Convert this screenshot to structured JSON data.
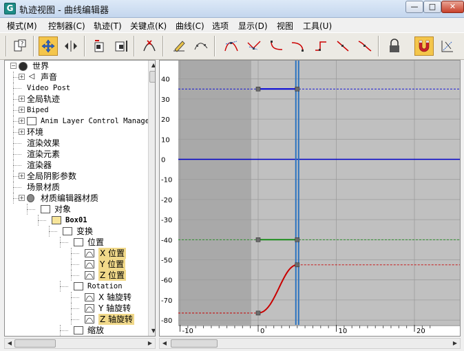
{
  "window": {
    "title": "轨迹视图 - 曲线编辑器",
    "icon_letter": "G",
    "minimize": "—",
    "maximize": "□",
    "close": "✕"
  },
  "menu": [
    "模式(M)",
    "控制器(C)",
    "轨迹(T)",
    "关键点(K)",
    "曲线(C)",
    "选项",
    "显示(D)",
    "视图",
    "工具(U)"
  ],
  "toolbar": {
    "buttons": [
      "filters-icon",
      "move-keys-icon",
      "slide-keys-icon",
      "scale-keys-icon",
      "scale-values-icon",
      "insert-keys-icon",
      "draw-curves-icon",
      "reduce-keys-icon",
      "tangent-auto-icon",
      "tangent-custom-icon",
      "tangent-fast-icon",
      "tangent-slow-icon",
      "tangent-step-icon",
      "tangent-linear-icon",
      "tangent-smooth-icon",
      "lock-selection-icon",
      "snap-frames-icon",
      "parameter-curve-icon"
    ],
    "active": [
      "move-keys-icon",
      "snap-frames-icon"
    ]
  },
  "tree": {
    "items": [
      {
        "label": "世界",
        "level": 0,
        "icon": "globe-icon",
        "expander": "−"
      },
      {
        "label": "声音",
        "level": 1,
        "icon": "sound-icon",
        "expander": "+"
      },
      {
        "label": "Video Post",
        "level": 1,
        "mono": true
      },
      {
        "label": "全局轨迹",
        "level": 1,
        "expander": "+"
      },
      {
        "label": "Biped",
        "level": 1,
        "mono": true,
        "expander": "+"
      },
      {
        "label": "Anim Layer Control Manage",
        "level": 1,
        "mono": true,
        "icon": "bracket-icon",
        "expander": "+"
      },
      {
        "label": "环境",
        "level": 1,
        "expander": "+"
      },
      {
        "label": "渲染效果",
        "level": 1
      },
      {
        "label": "渲染元素",
        "level": 1
      },
      {
        "label": "渲染器",
        "level": 1
      },
      {
        "label": "全局阴影参数",
        "level": 1,
        "expander": "+"
      },
      {
        "label": "场景材质",
        "level": 1
      },
      {
        "label": "材质编辑器材质",
        "level": 1,
        "icon": "sphere-icon",
        "expander": "+"
      },
      {
        "label": "对象",
        "level": 2,
        "icon": "object-icon"
      },
      {
        "label": "Box01",
        "level": 3,
        "icon": "box-icon",
        "mono": true,
        "bold": true
      },
      {
        "label": "变换",
        "level": 4,
        "icon": "transform-icon"
      },
      {
        "label": "位置",
        "level": 5,
        "icon": "position-icon"
      },
      {
        "label": "X 位置",
        "level": 6,
        "icon": "curve-icon",
        "selected": true
      },
      {
        "label": "Y 位置",
        "level": 6,
        "icon": "curve-icon",
        "selected": true
      },
      {
        "label": "Z 位置",
        "level": 6,
        "icon": "curve-icon",
        "selected": true
      },
      {
        "label": "Rotation",
        "level": 5,
        "icon": "rotation-icon",
        "mono": true
      },
      {
        "label": "X 轴旋转",
        "level": 6,
        "icon": "curve-icon"
      },
      {
        "label": "Y 轴旋转",
        "level": 6,
        "icon": "curve-icon"
      },
      {
        "label": "Z 轴旋转",
        "level": 6,
        "icon": "curve-icon",
        "selected": true
      },
      {
        "label": "缩放",
        "level": 5,
        "icon": "scale-icon"
      }
    ]
  },
  "graph": {
    "y_ticks": [
      "40",
      "30",
      "20",
      "10",
      "0",
      "-10",
      "-20",
      "-30",
      "-40",
      "-50",
      "-60",
      "-70",
      "-80"
    ],
    "x_ticks": [
      "-10",
      "0",
      "10",
      "20"
    ],
    "time_slider_frame": 5,
    "colors": {
      "background": "#c0c0c0",
      "out_of_range": "#a9a9a9",
      "grid": "#9c9c9c",
      "x_curve": "#0000d8",
      "y_curve": "#1a8c1a",
      "z_curve": "#c80000",
      "time_slider": "#2a72c0",
      "key": "#6d6d6d"
    },
    "curves": [
      {
        "name": "X 位置",
        "color_key": "x_curve",
        "keys": [
          [
            0,
            35
          ],
          [
            5,
            35
          ]
        ],
        "shape": "linear"
      },
      {
        "name": "Y 位置",
        "color_key": "y_curve",
        "keys": [
          [
            0,
            -40
          ],
          [
            5,
            -40
          ]
        ],
        "shape": "linear"
      },
      {
        "name": "Z 位置",
        "color_key": "z_curve",
        "keys": [
          [
            0,
            -76.5
          ],
          [
            5,
            -52.5
          ]
        ],
        "shape": "ease"
      },
      {
        "name": "Z 轴旋转",
        "color_key": "x_curve",
        "keys": [],
        "shape": "flat",
        "value": 0
      }
    ]
  }
}
